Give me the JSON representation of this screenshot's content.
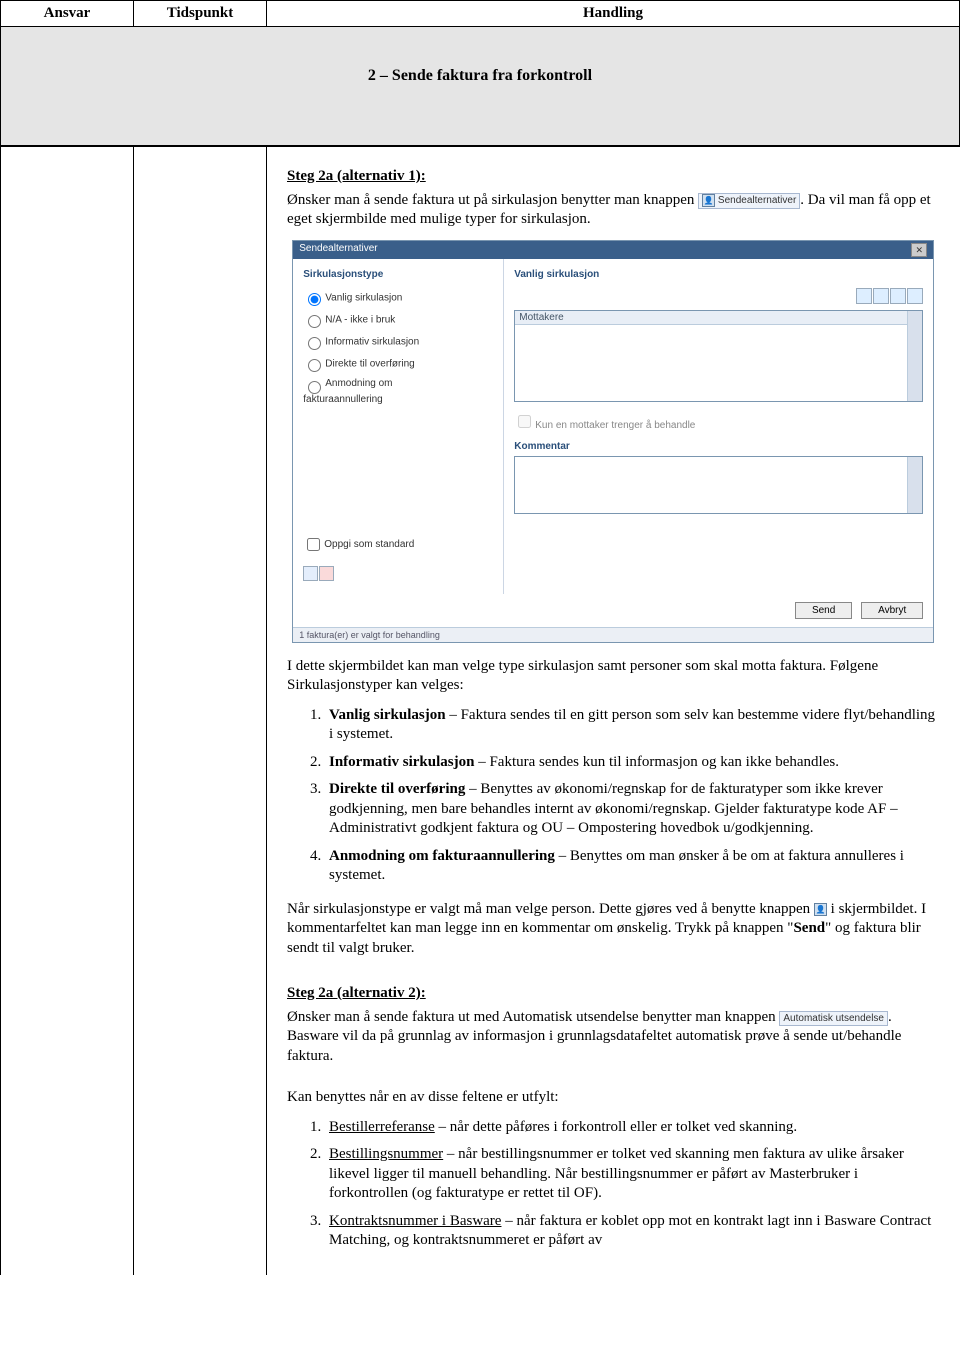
{
  "header": {
    "col1": "Ansvar",
    "col2": "Tidspunkt",
    "col3": "Handling"
  },
  "section_title": "2 – Sende faktura fra forkontroll",
  "step2a1": {
    "heading": "Steg 2a (alternativ 1):",
    "para1_a": "Ønsker man å sende faktura ut på sirkulasjon benytter man knappen",
    "btn_label": "Sendealternativer",
    "para1_b": ". Da vil man få opp et eget skjermbilde med mulige typer for sirkulasjon."
  },
  "dialog": {
    "title": "Sendealternativer",
    "left_hdr": "Sirkulasjonstype",
    "radios": {
      "r1": "Vanlig sirkulasjon",
      "r2": "N/A - ikke i bruk",
      "r3": "Informativ sirkulasjon",
      "r4": "Direkte til overføring",
      "r5a": "Anmodning om",
      "r5b": "fakturaannullering"
    },
    "std_label": "Oppgi som standard",
    "right_hdr": "Vanlig sirkulasjon",
    "listhdr": "Mottakere",
    "chk_label": "Kun en mottaker trenger å behandle",
    "kommentar_label": "Kommentar",
    "send": "Send",
    "cancel": "Avbryt",
    "status": "1 faktura(er) er valgt for behandling"
  },
  "mid": {
    "para2": "I dette skjermbildet kan man velge type sirkulasjon samt personer som skal motta faktura. Følgene Sirkulasjonstyper kan velges:",
    "li1_b": "Vanlig sirkulasjon",
    "li1_t": " – Faktura sendes til en gitt person som selv kan bestemme videre flyt/behandling i systemet.",
    "li2_b": "Informativ sirkulasjon",
    "li2_t": " – Faktura sendes kun til informasjon og kan ikke behandles.",
    "li3_b": "Direkte til overføring",
    "li3_t": " – Benyttes av økonomi/regnskap for de fakturatyper som ikke krever godkjenning, men bare behandles internt av økonomi/regnskap. Gjelder fakturatype kode AF – Administrativt godkjent faktura og OU – Ompostering hovedbok u/godkjenning.",
    "li4_b": "Anmodning om fakturaannullering",
    "li4_t": " – Benyttes om man ønsker å be om at faktura annulleres i systemet.",
    "para3a": "Når sirkulasjonstype er valgt må man velge person. Dette gjøres ved å benytte knappen ",
    "para3b": " i skjermbildet. I kommentarfeltet kan man legge inn en kommentar om ønskelig. Trykk på knappen \"",
    "send_bold": "Send",
    "para3c": "\" og faktura blir sendt til valgt bruker."
  },
  "step2a2": {
    "heading": "Steg 2a (alternativ 2):",
    "para1a": "Ønsker man å sende faktura ut med Automatisk utsendelse benytter man knappen",
    "btn_label": "Automatisk utsendelse",
    "para1b": ". Basware vil da på grunnlag av informasjon i grunnlagsdatafeltet automatisk prøve å sende ut/behandle faktura.",
    "para2": "Kan benyttes når en av disse feltene er utfylt:",
    "li1_u": "Bestillerreferanse",
    "li1_t": " – når dette påføres i forkontroll eller er tolket ved skanning.",
    "li2_u": "Bestillingsnummer",
    "li2_t": " – når bestillingsnummer er tolket ved skanning men faktura av ulike årsaker likevel ligger til manuell behandling. Når bestillingsnummer er påført av Masterbruker i forkontrollen (og fakturatype er rettet til OF).",
    "li3_u": "Kontraktsnummer i Basware",
    "li3_t": " – når faktura er koblet opp mot en kontrakt lagt inn i Basware Contract Matching, og kontraktsnummeret er påført av"
  }
}
